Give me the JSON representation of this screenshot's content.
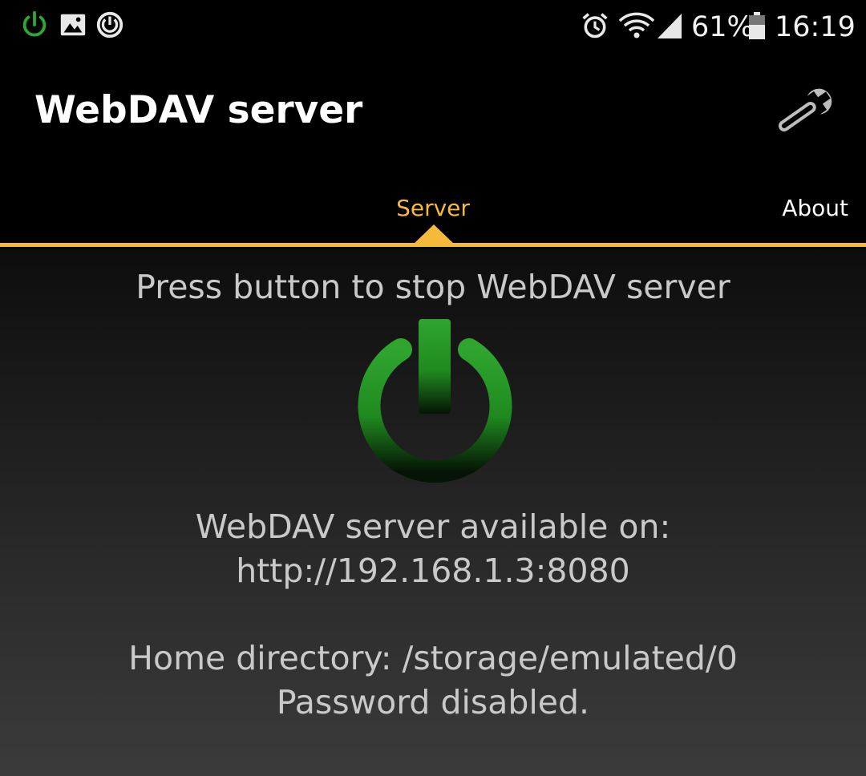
{
  "status_bar": {
    "left_icons": [
      "power-icon",
      "image-icon",
      "sync-icon"
    ],
    "right_icons": [
      "alarm-icon",
      "wifi-icon",
      "cell-signal-icon",
      "battery-icon"
    ],
    "battery": "61%",
    "time": "16:19"
  },
  "app_bar": {
    "title": "WebDAV server",
    "settings_icon": "wrench-icon"
  },
  "tabs": [
    {
      "label": "Server",
      "selected": true
    },
    {
      "label": "About",
      "selected": false
    }
  ],
  "main": {
    "instruction": "Press button to stop WebDAV server",
    "power_button_icon": "power-icon",
    "available_label": "WebDAV server available on:",
    "url": "http://192.168.1.3:8080",
    "home_directory": "Home directory: /storage/emulated/0",
    "password_status": "Password disabled."
  },
  "colors": {
    "accent": "#f6b93a",
    "power_green": "#2e9e2e",
    "text_gray": "#c9c9c9",
    "background": "#000000"
  }
}
